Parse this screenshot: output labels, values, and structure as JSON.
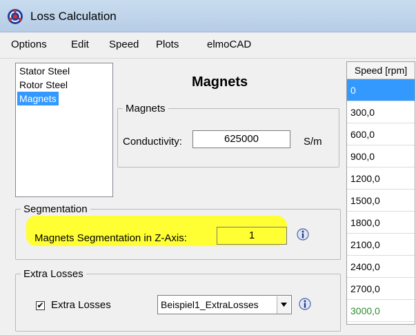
{
  "window": {
    "title": "Loss Calculation"
  },
  "menu": [
    "Options",
    "Edit",
    "Speed",
    "Plots",
    "elmoCAD"
  ],
  "loss_types": {
    "items": [
      "Stator Steel",
      "Rotor Steel",
      "Magnets"
    ],
    "selected": "Magnets"
  },
  "panel": {
    "title": "Magnets",
    "magnets_group": {
      "legend": "Magnets",
      "conductivity_label": "Conductivity:",
      "conductivity_value": "625000",
      "conductivity_unit": "S/m"
    },
    "segmentation_group": {
      "legend": "Segmentation",
      "z_axis_label": "Magnets Segmentation in Z-Axis:",
      "z_axis_value": "1"
    },
    "extra_losses_group": {
      "legend": "Extra Losses",
      "checkbox_label": "Extra Losses",
      "checkbox_checked": true,
      "checkbox_glyph": "✔",
      "selected_file": "Beispiel1_ExtraLosses"
    }
  },
  "speed_table": {
    "header": "Speed [rpm]",
    "rows": [
      "0",
      "300,0",
      "600,0",
      "900,0",
      "1200,0",
      "1500,0",
      "1800,0",
      "2100,0",
      "2400,0",
      "2700,0",
      "3000,0"
    ],
    "selected_row": "0"
  },
  "colors": {
    "selection": "#3399ff",
    "highlight": "#ffff33",
    "last_row_text": "#2e8b2e"
  },
  "icons": {
    "app": "app-logo-icon",
    "info": "info-icon",
    "dropdown": "chevron-down-icon"
  }
}
